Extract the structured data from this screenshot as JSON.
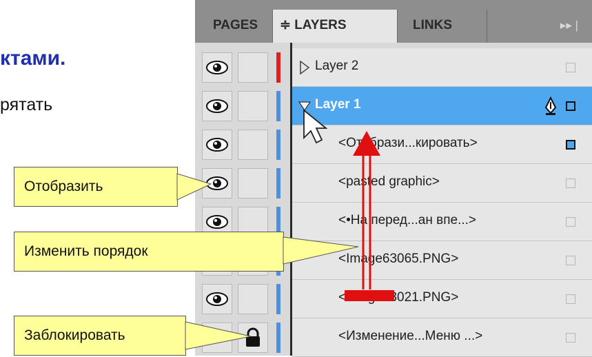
{
  "slide": {
    "title_fragment": "ктами.",
    "body_fragment": "рятать"
  },
  "tabs": [
    {
      "label": "PAGES"
    },
    {
      "label": "≑ LAYERS"
    },
    {
      "label": "LINKS"
    }
  ],
  "panel_menu_label": "▸▸ |",
  "rows": [
    {
      "label": "Layer 2",
      "kind": "layer",
      "expanded": false,
      "color": "#e02020",
      "selected": false,
      "eye": true,
      "lock": false
    },
    {
      "label": "Layer 1",
      "kind": "layer",
      "expanded": true,
      "color": "#4f8fe0",
      "selected": true,
      "eye": true,
      "lock": false
    },
    {
      "label": "<Отобрази...кировать>",
      "kind": "object",
      "color": "#4f8fe0",
      "selected": false,
      "eye": true,
      "lock": false
    },
    {
      "label": "<pasted graphic>",
      "kind": "object",
      "color": "#4f8fe0",
      "selected": false,
      "eye": true,
      "lock": false
    },
    {
      "label": "<•На перед...ан впе...>",
      "kind": "object",
      "color": "#4f8fe0",
      "selected": false,
      "eye": true,
      "lock": false
    },
    {
      "label": "<Image63065.PNG>",
      "kind": "object",
      "color": "#4f8fe0",
      "selected": false,
      "eye": true,
      "lock": false
    },
    {
      "label": "<Image63021.PNG>",
      "kind": "object",
      "color": "#4f8fe0",
      "selected": false,
      "eye": true,
      "lock": false
    },
    {
      "label": "<Изменение...Меню ...>",
      "kind": "object",
      "color": "#4f8fe0",
      "selected": false,
      "eye": false,
      "lock": true
    }
  ],
  "callouts": {
    "show": "Отобразить",
    "reorder": "Изменить порядок",
    "lock": "Заблокировать"
  },
  "colors": {
    "accent": "#4fa7ef",
    "arrow": "#e01010",
    "callout_bg": "#ffff99",
    "title": "#1f2fb0"
  },
  "icons": [
    "eye-icon",
    "lock-icon",
    "pen-icon",
    "disclosure-triangle-icon",
    "cursor-icon",
    "panel-menu-icon"
  ]
}
